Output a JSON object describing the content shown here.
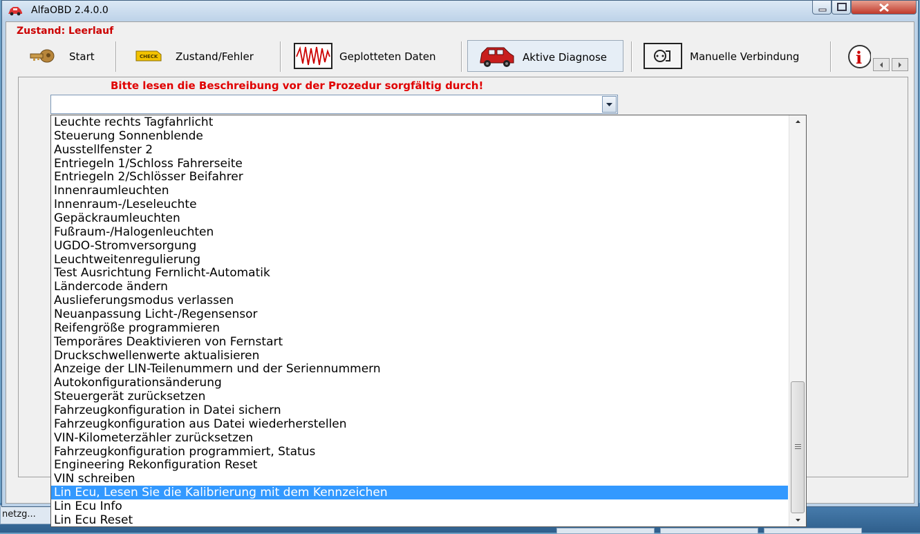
{
  "window": {
    "title": "AlfaOBD 2.4.0.0"
  },
  "status": {
    "text": "Zustand: Leerlauf"
  },
  "toolbar": {
    "items": [
      {
        "label": "Start",
        "icon": "key-icon"
      },
      {
        "label": "Zustand/Fehler",
        "icon": "check-engine-icon"
      },
      {
        "label": "Geplotteten Daten",
        "icon": "waveform-icon"
      },
      {
        "label": "Aktive Diagnose",
        "icon": "car-icon",
        "active": true
      },
      {
        "label": "Manuelle Verbindung",
        "icon": "connector-icon"
      }
    ]
  },
  "procedure": {
    "instruction": "Bitte lesen die Beschreibung vor der Prozedur sorgfältig durch!",
    "selected_value": "",
    "options": [
      "Leuchte rechts Tagfahrlicht",
      "Steuerung Sonnenblende",
      "Ausstellfenster 2",
      "Entriegeln 1/Schloss Fahrerseite",
      "Entriegeln 2/Schlösser Beifahrer",
      "Innenraumleuchten",
      "Innenraum-/Leseleuchte",
      "Gepäckraumleuchten",
      "Fußraum-/Halogenleuchten",
      "UGDO-Stromversorgung",
      "Leuchtweitenregulierung",
      "Test Ausrichtung Fernlicht-Automatik",
      "Ländercode ändern",
      "Auslieferungsmodus verlassen",
      "Neuanpassung Licht-/Regensensor",
      "Reifengröße programmieren",
      "Temporäres Deaktivieren von Fernstart",
      "Druckschwellenwerte aktualisieren",
      "Anzeige der LIN-Teilenummern und der Seriennummern",
      "Autokonfigurationsänderung",
      "Steuergerät zurücksetzen",
      "Fahrzeugkonfiguration in Datei sichern",
      "Fahrzeugkonfiguration aus Datei wiederherstellen",
      "VIN-Kilometerzähler zurücksetzen",
      "Fahrzeugkonfiguration programmiert, Status",
      "Engineering Rekonfiguration Reset",
      "VIN schreiben",
      "Lin Ecu, Lesen Sie die Kalibrierung mit dem Kennzeichen",
      "Lin Ecu Info",
      "Lin Ecu Reset"
    ],
    "highlighted_option": "Lin Ecu, Lesen Sie die Kalibrierung mit dem Kennzeichen"
  },
  "desktop": {
    "taskbar_label": "netzg..."
  },
  "colors": {
    "status_red": "#cc0000",
    "highlight": "#3399ff",
    "instruction_red": "#e00000"
  }
}
